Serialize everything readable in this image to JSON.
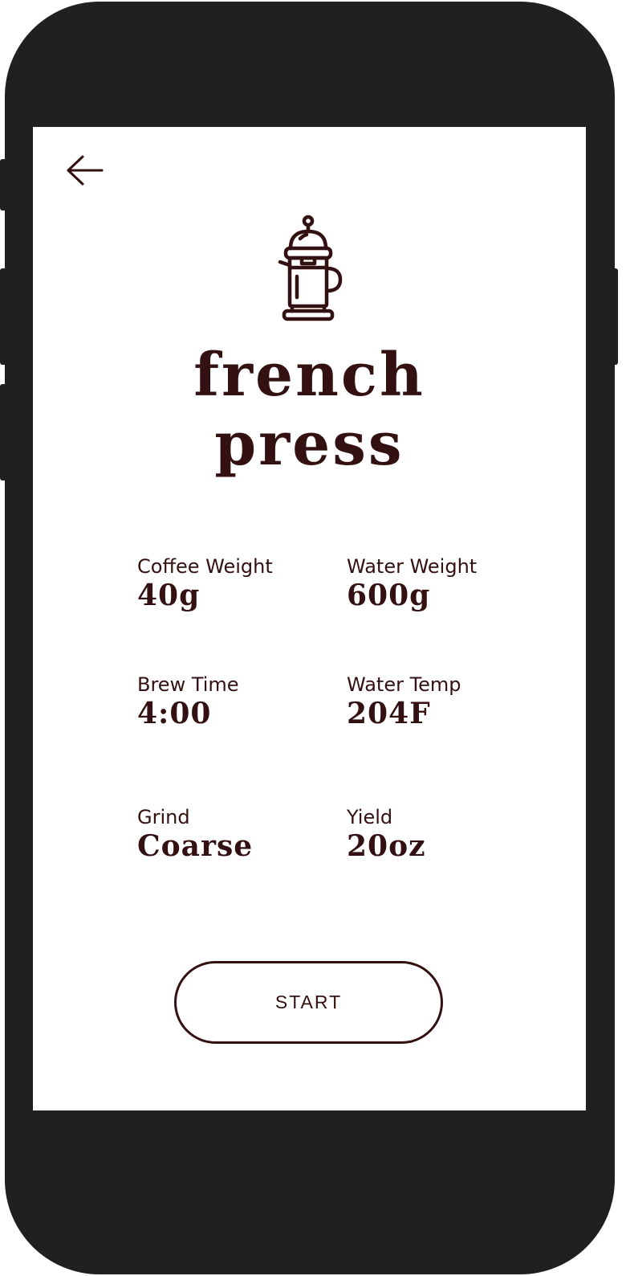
{
  "colors": {
    "ink": "#331011",
    "device": "#202020",
    "screen": "#ffffff"
  },
  "header": {
    "back_icon": "arrow-left-icon",
    "brew_icon": "french-press-icon"
  },
  "title": {
    "line1": "french",
    "line2": "press"
  },
  "recipe": [
    {
      "label": "Coffee Weight",
      "value": "40g"
    },
    {
      "label": "Water Weight",
      "value": "600g"
    },
    {
      "label": "Brew Time",
      "value": "4:00"
    },
    {
      "label": "Water Temp",
      "value": "204F"
    },
    {
      "label": "Grind",
      "value": "Coarse"
    },
    {
      "label": "Yield",
      "value": "20oz"
    }
  ],
  "actions": {
    "start_label": "START"
  }
}
